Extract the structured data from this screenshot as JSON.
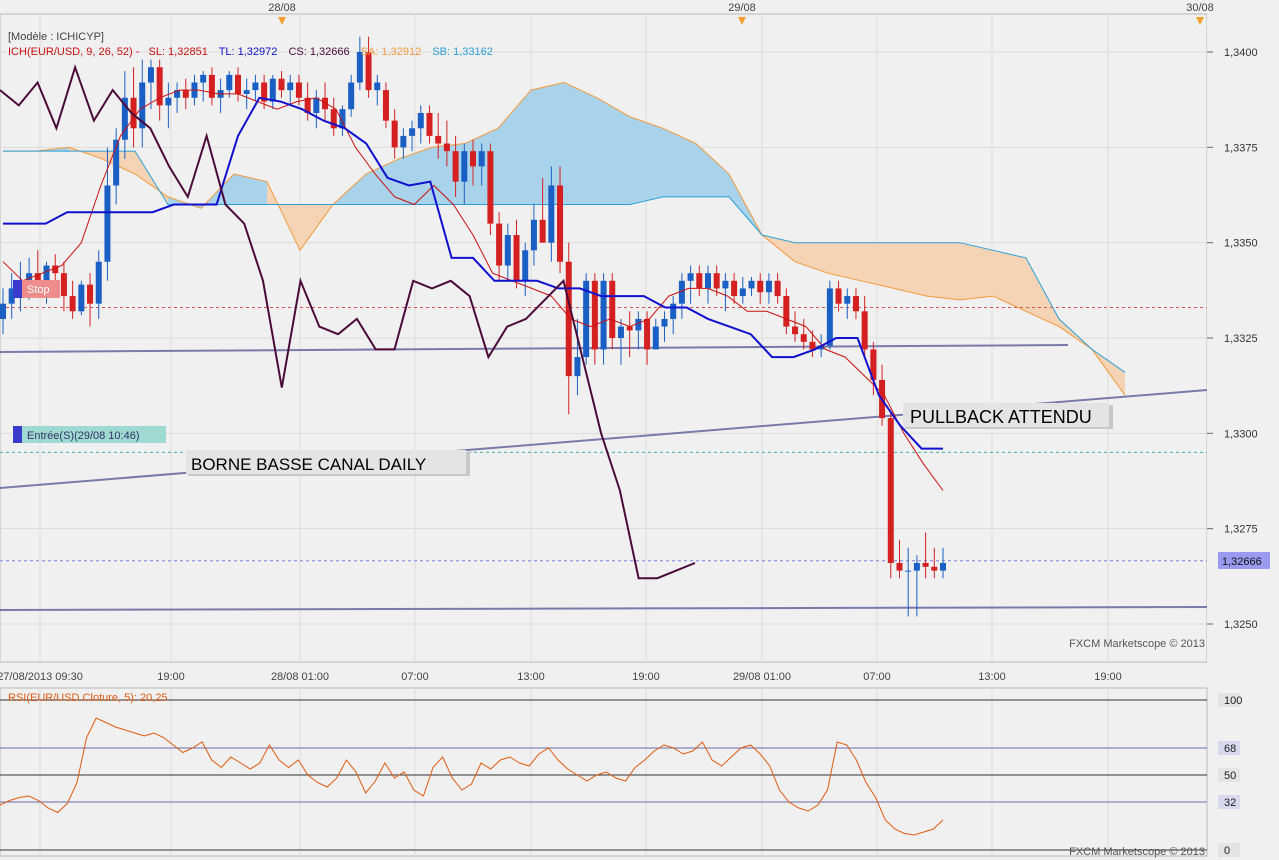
{
  "header": {
    "model": "[Modèle : ICHICYP]",
    "ich_label": "ICH(EUR/USD, 9, 26, 52) -",
    "sl": "SL: 1,32851",
    "tl": "TL: 1,32972",
    "cs": "CS: 1,32666",
    "sa": "SA: 1,32912",
    "sb": "SB: 1,33162"
  },
  "top_dates": [
    "28/08",
    "29/08",
    "30/08"
  ],
  "x_labels": [
    "27/08/2013 09:30",
    "19:00",
    "28/08 01:00",
    "07:00",
    "13:00",
    "19:00",
    "29/08 01:00",
    "07:00",
    "13:00",
    "19:00"
  ],
  "price_axis": {
    "ticks": [
      "1,3400",
      "1,3375",
      "1,3350",
      "1,3325",
      "1,3300",
      "1,3275",
      "1,3250"
    ],
    "current": "1,32666"
  },
  "annotations": {
    "stop": "Stop",
    "entry": "Entrée(S)(29/08 10:46)",
    "pullback": "PULLBACK ATTENDU",
    "borne": "BORNE BASSE CANAL DAILY"
  },
  "watermarks": {
    "main": "FXCM Marketscope © 2013",
    "rsi": "FXCM Marketscope © 2013"
  },
  "rsi_panel": {
    "label": "RSI(EUR/USD.Cloture, 5): 20,25",
    "levels": [
      "100",
      "68",
      "50",
      "32",
      "0"
    ]
  },
  "colors": {
    "bull": "#1a5fc4",
    "bear": "#d42020",
    "tenkan": "#cc1010",
    "kijun": "#1010d0",
    "chikou": "#4a0a3a",
    "senkou_a": "#f29a3c",
    "senkou_b": "#2a9fd8",
    "kumo_bull": "#a9d3ea",
    "kumo_bear": "#f5d3b5",
    "rsi": "#e05a10"
  },
  "chart_data": {
    "type": "candlestick",
    "instrument": "EUR/USD",
    "ylim": [
      1.324,
      1.341
    ],
    "stop_level": 1.3333,
    "entry_level": 1.3295,
    "current_price": 1.32666,
    "candles": [
      [
        1.333,
        1.3338,
        1.3326,
        1.3334
      ],
      [
        1.3334,
        1.3342,
        1.333,
        1.3338
      ],
      [
        1.3338,
        1.3345,
        1.3332,
        1.334
      ],
      [
        1.334,
        1.3346,
        1.3335,
        1.3342
      ],
      [
        1.3342,
        1.3348,
        1.3336,
        1.334
      ],
      [
        1.334,
        1.3345,
        1.3334,
        1.3344
      ],
      [
        1.3344,
        1.3347,
        1.3338,
        1.3342
      ],
      [
        1.3342,
        1.3345,
        1.3332,
        1.3336
      ],
      [
        1.3336,
        1.334,
        1.333,
        1.3332
      ],
      [
        1.3332,
        1.334,
        1.3331,
        1.3339
      ],
      [
        1.3339,
        1.3342,
        1.3328,
        1.3334
      ],
      [
        1.3334,
        1.3348,
        1.333,
        1.3345
      ],
      [
        1.3345,
        1.3375,
        1.334,
        1.3365
      ],
      [
        1.3365,
        1.338,
        1.336,
        1.3377
      ],
      [
        1.3377,
        1.3395,
        1.3372,
        1.3388
      ],
      [
        1.3388,
        1.3396,
        1.3375,
        1.338
      ],
      [
        1.338,
        1.3398,
        1.3375,
        1.3392
      ],
      [
        1.3392,
        1.3398,
        1.3385,
        1.3396
      ],
      [
        1.3396,
        1.3398,
        1.3382,
        1.3386
      ],
      [
        1.3386,
        1.3392,
        1.338,
        1.3388
      ],
      [
        1.3388,
        1.3392,
        1.3384,
        1.339
      ],
      [
        1.339,
        1.3393,
        1.3385,
        1.3388
      ],
      [
        1.3388,
        1.3394,
        1.3386,
        1.3392
      ],
      [
        1.3392,
        1.3395,
        1.3387,
        1.3394
      ],
      [
        1.3394,
        1.3396,
        1.3386,
        1.3388
      ],
      [
        1.3388,
        1.3393,
        1.3384,
        1.339
      ],
      [
        1.339,
        1.3395,
        1.3388,
        1.3394
      ],
      [
        1.3394,
        1.3396,
        1.3387,
        1.3389
      ],
      [
        1.3389,
        1.3393,
        1.3385,
        1.339
      ],
      [
        1.339,
        1.3394,
        1.3387,
        1.3392
      ],
      [
        1.3392,
        1.3394,
        1.3385,
        1.3387
      ],
      [
        1.3387,
        1.3394,
        1.3385,
        1.3393
      ],
      [
        1.3393,
        1.3395,
        1.3388,
        1.339
      ],
      [
        1.339,
        1.3394,
        1.3386,
        1.3392
      ],
      [
        1.3392,
        1.3394,
        1.3386,
        1.3388
      ],
      [
        1.3388,
        1.3392,
        1.3382,
        1.3384
      ],
      [
        1.3384,
        1.339,
        1.338,
        1.3388
      ],
      [
        1.3388,
        1.3392,
        1.3382,
        1.3385
      ],
      [
        1.3385,
        1.3388,
        1.3378,
        1.338
      ],
      [
        1.338,
        1.3386,
        1.3378,
        1.3385
      ],
      [
        1.3385,
        1.3394,
        1.3383,
        1.3392
      ],
      [
        1.3392,
        1.3404,
        1.339,
        1.34
      ],
      [
        1.34,
        1.3404,
        1.3388,
        1.339
      ],
      [
        1.339,
        1.3394,
        1.3386,
        1.3392
      ],
      [
        1.339,
        1.3392,
        1.338,
        1.3382
      ],
      [
        1.3382,
        1.3385,
        1.3372,
        1.3375
      ],
      [
        1.3375,
        1.338,
        1.3372,
        1.3378
      ],
      [
        1.3378,
        1.3382,
        1.3374,
        1.338
      ],
      [
        1.338,
        1.3386,
        1.3376,
        1.3384
      ],
      [
        1.3384,
        1.3386,
        1.3376,
        1.3378
      ],
      [
        1.3378,
        1.3384,
        1.3372,
        1.3376
      ],
      [
        1.3376,
        1.3382,
        1.337,
        1.3374
      ],
      [
        1.3374,
        1.3378,
        1.3362,
        1.3366
      ],
      [
        1.3366,
        1.3376,
        1.336,
        1.3374
      ],
      [
        1.3374,
        1.3377,
        1.3365,
        1.337
      ],
      [
        1.337,
        1.3376,
        1.3365,
        1.3374
      ],
      [
        1.3374,
        1.3376,
        1.3352,
        1.3355
      ],
      [
        1.3355,
        1.3358,
        1.334,
        1.3344
      ],
      [
        1.3344,
        1.3355,
        1.334,
        1.3352
      ],
      [
        1.3352,
        1.3356,
        1.3338,
        1.334
      ],
      [
        1.334,
        1.335,
        1.3336,
        1.3348
      ],
      [
        1.3348,
        1.336,
        1.3344,
        1.3356
      ],
      [
        1.3356,
        1.3367,
        1.335,
        1.335
      ],
      [
        1.335,
        1.337,
        1.3345,
        1.3365
      ],
      [
        1.3365,
        1.337,
        1.3342,
        1.3345
      ],
      [
        1.3345,
        1.335,
        1.3305,
        1.3315
      ],
      [
        1.3315,
        1.333,
        1.331,
        1.332
      ],
      [
        1.332,
        1.3342,
        1.3318,
        1.334
      ],
      [
        1.334,
        1.3342,
        1.3318,
        1.3322
      ],
      [
        1.3322,
        1.3342,
        1.3318,
        1.334
      ],
      [
        1.334,
        1.3342,
        1.3322,
        1.3325
      ],
      [
        1.3325,
        1.333,
        1.3318,
        1.3328
      ],
      [
        1.3328,
        1.3332,
        1.332,
        1.3327
      ],
      [
        1.3327,
        1.3332,
        1.3322,
        1.333
      ],
      [
        1.333,
        1.3332,
        1.3318,
        1.3322
      ],
      [
        1.3322,
        1.333,
        1.3322,
        1.3328
      ],
      [
        1.3328,
        1.3332,
        1.3324,
        1.333
      ],
      [
        1.333,
        1.3336,
        1.3326,
        1.3334
      ],
      [
        1.3334,
        1.3342,
        1.333,
        1.334
      ],
      [
        1.334,
        1.3344,
        1.3334,
        1.3342
      ],
      [
        1.3342,
        1.3344,
        1.3336,
        1.3338
      ],
      [
        1.3338,
        1.3344,
        1.3334,
        1.3342
      ],
      [
        1.3342,
        1.3344,
        1.3336,
        1.3338
      ],
      [
        1.3338,
        1.3342,
        1.3332,
        1.334
      ],
      [
        1.334,
        1.3342,
        1.3334,
        1.3336
      ],
      [
        1.3336,
        1.3341,
        1.3334,
        1.3338
      ],
      [
        1.3338,
        1.3341,
        1.3336,
        1.334
      ],
      [
        1.334,
        1.3342,
        1.3334,
        1.3337
      ],
      [
        1.3337,
        1.3342,
        1.3334,
        1.334
      ],
      [
        1.334,
        1.3342,
        1.3334,
        1.3336
      ],
      [
        1.3336,
        1.3338,
        1.3326,
        1.3328
      ],
      [
        1.3328,
        1.3332,
        1.3324,
        1.3326
      ],
      [
        1.3326,
        1.333,
        1.3322,
        1.3324
      ],
      [
        1.3324,
        1.3327,
        1.332,
        1.3322
      ],
      [
        1.3322,
        1.3326,
        1.332,
        1.3323
      ],
      [
        1.3323,
        1.334,
        1.3322,
        1.3338
      ],
      [
        1.3338,
        1.334,
        1.3332,
        1.3334
      ],
      [
        1.3334,
        1.3338,
        1.333,
        1.3336
      ],
      [
        1.3336,
        1.3338,
        1.333,
        1.3332
      ],
      [
        1.3332,
        1.3336,
        1.332,
        1.3322
      ],
      [
        1.3322,
        1.3324,
        1.331,
        1.3314
      ],
      [
        1.3314,
        1.3318,
        1.3302,
        1.3304
      ],
      [
        1.3304,
        1.3306,
        1.3262,
        1.3266
      ],
      [
        1.3266,
        1.3272,
        1.3262,
        1.3264
      ],
      [
        1.3264,
        1.327,
        1.3252,
        1.3264
      ],
      [
        1.3264,
        1.3268,
        1.3252,
        1.3266
      ],
      [
        1.3266,
        1.3274,
        1.3262,
        1.3265
      ],
      [
        1.3265,
        1.327,
        1.3262,
        1.3264
      ],
      [
        1.3264,
        1.327,
        1.3262,
        1.3266
      ]
    ],
    "tenkan": [
      1.3345,
      1.334,
      1.3342,
      1.3344,
      1.335,
      1.3365,
      1.3378,
      1.3385,
      1.3388,
      1.339,
      1.339,
      1.3389,
      1.3389,
      1.3387,
      1.3385,
      1.3387,
      1.3388,
      1.3385,
      1.3375,
      1.3368,
      1.3362,
      1.336,
      1.3365,
      1.336,
      1.3352,
      1.3342,
      1.334,
      1.3338,
      1.3336,
      1.333,
      1.3328,
      1.333,
      1.3328,
      1.333,
      1.3336,
      1.3338,
      1.3338,
      1.3336,
      1.3332,
      1.3332,
      1.333,
      1.3328,
      1.3322,
      1.332,
      1.3315,
      1.331,
      1.33,
      1.3292,
      1.3285
    ],
    "kijun": [
      1.3355,
      1.3355,
      1.3355,
      1.3358,
      1.3358,
      1.3358,
      1.3358,
      1.3358,
      1.336,
      1.336,
      1.336,
      1.3378,
      1.3388,
      1.3387,
      1.3385,
      1.3382,
      1.338,
      1.3376,
      1.3367,
      1.3365,
      1.3366,
      1.3346,
      1.3346,
      1.334,
      1.334,
      1.334,
      1.3338,
      1.3338,
      1.3336,
      1.3336,
      1.3336,
      1.3333,
      1.3333,
      1.333,
      1.3328,
      1.3326,
      1.332,
      1.332,
      1.3322,
      1.3325,
      1.3325,
      1.331,
      1.3302,
      1.3296,
      1.3296
    ],
    "senkou_a": [
      1.3374,
      1.3374,
      1.3375,
      1.3372,
      1.3368,
      1.3362,
      1.3359,
      1.3368,
      1.3366,
      1.3348,
      1.336,
      1.3368,
      1.3372,
      1.3375,
      1.3376,
      1.338,
      1.339,
      1.3392,
      1.3388,
      1.3383,
      1.338,
      1.3376,
      1.3368,
      1.3352,
      1.3345,
      1.3342,
      1.334,
      1.3338,
      1.3336,
      1.3335,
      1.3336,
      1.3332,
      1.3328,
      1.3322,
      1.331,
      1.3298,
      1.329
    ],
    "senkou_b": [
      1.3374,
      1.3374,
      1.3374,
      1.3374,
      1.3374,
      1.336,
      1.336,
      1.336,
      1.336,
      1.336,
      1.336,
      1.336,
      1.336,
      1.336,
      1.336,
      1.336,
      1.336,
      1.336,
      1.336,
      1.336,
      1.3362,
      1.3362,
      1.3362,
      1.3352,
      1.335,
      1.335,
      1.335,
      1.335,
      1.335,
      1.335,
      1.3348,
      1.3346,
      1.333,
      1.3322,
      1.3316
    ],
    "chikou": [
      1.339,
      1.3386,
      1.3392,
      1.338,
      1.3396,
      1.3382,
      1.339,
      1.3384,
      1.338,
      1.337,
      1.3362,
      1.3378,
      1.336,
      1.3355,
      1.334,
      1.3312,
      1.334,
      1.3328,
      1.3326,
      1.333,
      1.3322,
      1.3322,
      1.334,
      1.3338,
      1.334,
      1.3336,
      1.332,
      1.3328,
      1.333,
      1.3335,
      1.334,
      1.332,
      1.33,
      1.3285,
      1.3262,
      1.3262,
      1.3264,
      1.3266
    ],
    "rsi": [
      30,
      33,
      35,
      36,
      33,
      28,
      25,
      31,
      45,
      75,
      88,
      85,
      82,
      80,
      78,
      76,
      78,
      75,
      70,
      65,
      68,
      72,
      60,
      55,
      62,
      58,
      54,
      58,
      70,
      60,
      55,
      60,
      50,
      45,
      42,
      48,
      60,
      52,
      38,
      46,
      58,
      48,
      52,
      40,
      36,
      55,
      62,
      48,
      40,
      44,
      58,
      54,
      60,
      62,
      58,
      56,
      64,
      68,
      60,
      54,
      50,
      46,
      50,
      52,
      48,
      46,
      55,
      60,
      66,
      70,
      68,
      64,
      66,
      72,
      60,
      56,
      62,
      68,
      70,
      64,
      56,
      40,
      32,
      28,
      26,
      30,
      40,
      72,
      70,
      60,
      45,
      35,
      20,
      14,
      11,
      10,
      12,
      14,
      20
    ]
  }
}
